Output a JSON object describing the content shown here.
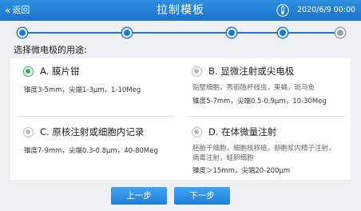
{
  "header": {
    "back_label": "返回",
    "title": "拉制模板",
    "datetime": "2020/6/9  00:00"
  },
  "stepper": {
    "steps": [
      {
        "state": "active"
      },
      {
        "state": "active"
      },
      {
        "state": "active"
      },
      {
        "state": "active"
      },
      {
        "state": "inactive"
      }
    ]
  },
  "question": "选择微电极的用途:",
  "options": [
    {
      "label": "A. 膜片钳",
      "selected": true,
      "desc_lines": [
        "锥度3-5mm，尖端1-3μm，1-10Meg"
      ]
    },
    {
      "label": "B. 显微注射或尖电极",
      "selected": false,
      "desc_lines": [
        "贴壁细胞，秀丽隐杆线虫，果蝇，斑马鱼",
        "锥度5-7mm，尖端0.5-0.9μm，10-30Meg"
      ]
    },
    {
      "label": "C. 原核注射或细胞内记录",
      "selected": false,
      "desc_lines": [
        "锥度7-9mm，尖端0.3-0.8μm，40-80Meg"
      ]
    },
    {
      "label": "D. 在体微量注射",
      "selected": false,
      "desc_lines": [
        "胚胎干细胞，细胞核移植，卵胞浆内精子注射，",
        "病毒注射，蛙卵细胞",
        "锥度＞15mm，尖端20-200μm"
      ]
    }
  ],
  "buttons": {
    "prev_label": "上一步",
    "next_label": "下一步"
  },
  "colors": {
    "header": "#1b73c9",
    "accent": "#1c78d4",
    "selected": "#2db24a",
    "background": "#eef0f3"
  },
  "icons": {
    "back": "chevron-double-left-icon",
    "thermometer": "thermometer-icon",
    "radio": "radio-icon"
  }
}
